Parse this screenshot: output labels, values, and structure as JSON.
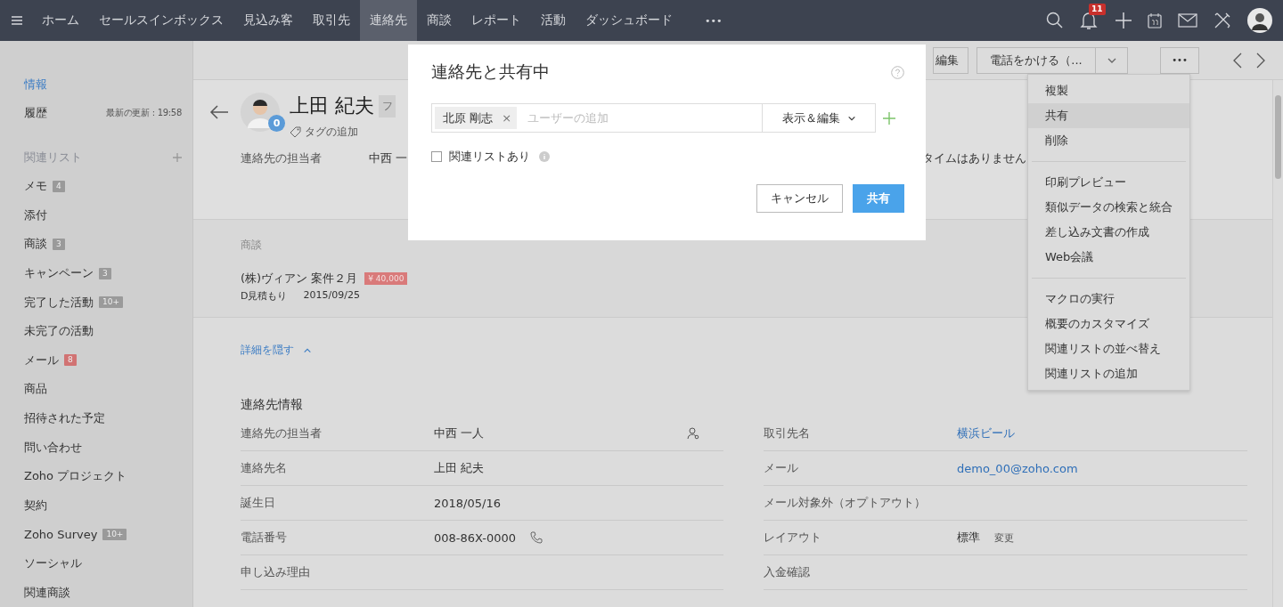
{
  "nav": {
    "items": [
      {
        "label": "ホーム",
        "selected": false
      },
      {
        "label": "セールスインボックス",
        "selected": false
      },
      {
        "label": "見込み客",
        "selected": false
      },
      {
        "label": "取引先",
        "selected": false
      },
      {
        "label": "連絡先",
        "selected": true
      },
      {
        "label": "商談",
        "selected": false
      },
      {
        "label": "レポート",
        "selected": false
      },
      {
        "label": "活動",
        "selected": false
      },
      {
        "label": "ダッシュボード",
        "selected": false
      }
    ],
    "more": "•••",
    "notifications": "11"
  },
  "sidebar": {
    "items": [
      {
        "label": "情報",
        "selected": true
      },
      {
        "label": "履歴",
        "selected": false,
        "meta": "最新の更新 : 19:58"
      }
    ],
    "related_title": "関連リスト",
    "related": [
      {
        "label": "メモ",
        "badge": "4",
        "color": "#9a9a9a"
      },
      {
        "label": "添付"
      },
      {
        "label": "商談",
        "badge": "3",
        "color": "#9a9a9a"
      },
      {
        "label": "キャンペーン",
        "badge": "3",
        "color": "#9a9a9a"
      },
      {
        "label": "完了した活動",
        "badge": "10+",
        "color": "#9a9a9a"
      },
      {
        "label": "未完了の活動"
      },
      {
        "label": "メール",
        "badge": "8",
        "color": "#d17373"
      },
      {
        "label": "商品"
      },
      {
        "label": "招待された予定"
      },
      {
        "label": "問い合わせ"
      },
      {
        "label": "Zoho プロジェクト"
      },
      {
        "label": "契約"
      },
      {
        "label": "Zoho Survey",
        "badge": "10+",
        "color": "#9a9a9a"
      },
      {
        "label": "ソーシャル"
      },
      {
        "label": "関連商談"
      }
    ]
  },
  "toolbar": {
    "edit": "編集",
    "call": "電話をかける（...",
    "more": "•••"
  },
  "record": {
    "name": "上田 紀夫",
    "badge": "0",
    "tag": "フ",
    "add_tag": "タグの追加",
    "owner_label": "連絡先の担当者",
    "owner_value": "中西 一",
    "right_text": "タイムはありません"
  },
  "deals": {
    "title": "商談",
    "items": [
      {
        "name": "(株)ヴィアン 案件２月",
        "amount": "¥ 40,000",
        "stage": "D見積もり",
        "date": "2015/09/25"
      }
    ]
  },
  "details": {
    "toggle": "詳細を隠す",
    "section": "連絡先情報",
    "left": [
      {
        "label": "連絡先の担当者",
        "value": "中西 一人",
        "kind": "owner"
      },
      {
        "label": "連絡先名",
        "value": "上田 紀夫",
        "kind": "text"
      },
      {
        "label": "誕生日",
        "value": "2018/05/16",
        "kind": "text"
      },
      {
        "label": "電話番号",
        "value": "008-86X-0000",
        "kind": "phone"
      },
      {
        "label": "申し込み理由",
        "kind": "text"
      }
    ],
    "right": [
      {
        "label": "取引先名",
        "value": "横浜ビール",
        "kind": "link"
      },
      {
        "label": "メール",
        "value": "demo_00@zoho.com",
        "kind": "link"
      },
      {
        "label": "メール対象外（オプトアウト）",
        "kind": "text"
      },
      {
        "label": "レイアウト",
        "value": "標準",
        "action": "変更",
        "kind": "text"
      },
      {
        "label": "入金確認",
        "kind": "text"
      }
    ]
  },
  "menu": {
    "groups": [
      [
        {
          "label": "複製",
          "selected": false
        },
        {
          "label": "共有",
          "selected": true
        },
        {
          "label": "削除",
          "selected": false
        }
      ],
      [
        {
          "label": "印刷プレビュー",
          "selected": false
        },
        {
          "label": "類似データの検索と統合",
          "selected": false
        },
        {
          "label": "差し込み文書の作成",
          "selected": false
        },
        {
          "label": "Web会議",
          "selected": false
        }
      ],
      [
        {
          "label": "マクロの実行",
          "selected": false
        },
        {
          "label": "概要のカスタマイズ",
          "selected": false
        },
        {
          "label": "関連リストの並べ替え",
          "selected": false
        },
        {
          "label": "関連リストの追加",
          "selected": false
        }
      ]
    ]
  },
  "dialog": {
    "title": "連絡先と共有中",
    "users": [
      "北原 剛志"
    ],
    "remove": "×",
    "placeholder": "ユーザーの追加",
    "permission": "表示＆編集",
    "related_label": "関連リストあり",
    "related_checked": false,
    "cancel": "キャンセル",
    "share": "共有"
  }
}
